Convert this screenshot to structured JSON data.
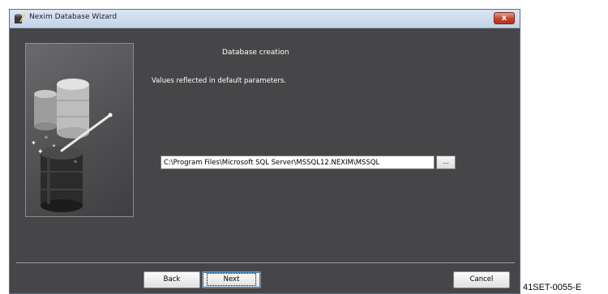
{
  "window": {
    "title": "Nexim Database Wizard",
    "close_glyph": "x",
    "icon": "wizard-app-icon"
  },
  "page": {
    "heading": "Database creation",
    "info": "Values reflected in default parameters."
  },
  "path_field": {
    "value": "C:\\Program Files\\Microsoft SQL Server\\MSSQL12.NEXIM\\MSSQL",
    "browse_label": "..."
  },
  "buttons": {
    "back": "Back",
    "next": "Next",
    "cancel": "Cancel"
  },
  "figure_ref": "41SET-0055-E",
  "illustration_icon": "database-wizard-wand-icon",
  "colors": {
    "client_bg": "#464648",
    "title_bar": "#c2d3e8",
    "close_button": "#c8432b"
  }
}
